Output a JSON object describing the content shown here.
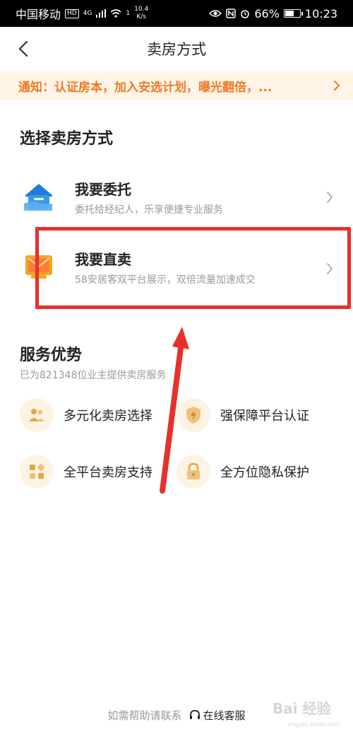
{
  "status_bar": {
    "carrier": "中国移动",
    "hd": "HD",
    "network": "4G",
    "wifi_count": "1",
    "speed_value": "10.4",
    "speed_unit": "K/s",
    "battery": "66%",
    "battery_level": 0.66,
    "time": "10:23"
  },
  "nav": {
    "title": "卖房方式"
  },
  "notice": {
    "text": "通知：认证房本，加入安选计划，曝光翻倍，..."
  },
  "choose": {
    "heading": "选择卖房方式",
    "options": [
      {
        "title": "我要委托",
        "desc": "委托给经纪人，乐享便捷专业服务"
      },
      {
        "title": "我要直卖",
        "desc": "58安居客双平台展示，双倍流量加速成交"
      }
    ]
  },
  "advantages": {
    "heading": "服务优势",
    "subtitle": "已为821348位业主提供卖房服务",
    "items": [
      {
        "label": "多元化卖房选择",
        "icon": "users-icon"
      },
      {
        "label": "强保障平台认证",
        "icon": "shield-bolt-icon"
      },
      {
        "label": "全平台卖房支持",
        "icon": "grid-icon"
      },
      {
        "label": "全方位隐私保护",
        "icon": "lock-icon"
      }
    ]
  },
  "footer": {
    "help_text": "如需帮助请联系",
    "service_label": "在线客服"
  },
  "watermark": {
    "brand": "Bai 经验",
    "site": "jingyan.baidu.com"
  },
  "colors": {
    "accent": "#f07a26",
    "notice_bg": "#fff4e6",
    "annotation_red": "#e8302a",
    "icon_gold": "#e0a64a",
    "icon_bg": "#fdf3e3"
  }
}
